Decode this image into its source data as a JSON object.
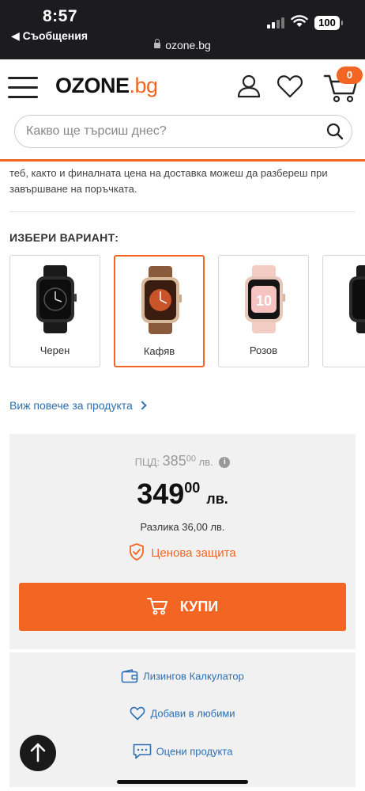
{
  "status_bar": {
    "time": "8:57",
    "back_label": "◀ Съобщения",
    "url": "ozone.bg",
    "battery": "100"
  },
  "header": {
    "logo_main": "OZONE",
    "logo_suffix": ".bg",
    "cart_count": "0",
    "search_placeholder": "Какво ще търсиш днес?",
    "accent_color": "#f26522"
  },
  "delivery_note": "теб, както и финалната цена на доставка можеш да разбереш при завършване на поръчката.",
  "variants": {
    "title": "ИЗБЕРИ ВАРИАНТ:",
    "items": [
      {
        "label": "Черен",
        "selected": false,
        "color": "#2a2a2a"
      },
      {
        "label": "Кафяв",
        "selected": true,
        "color": "#8a5a3c"
      },
      {
        "label": "Розов",
        "selected": false,
        "color": "#f2c6bd"
      },
      {
        "label": "",
        "selected": false,
        "color": "#2a2a2a"
      }
    ]
  },
  "more_link": "Виж повече за продукта",
  "price": {
    "old_label": "ПЦД:",
    "old_value": "385",
    "old_decimals": "00",
    "old_currency": "лв.",
    "info_icon": "i",
    "new_value": "349",
    "new_decimals": "00",
    "new_currency": "лв.",
    "difference": "Разлика 36,00 лв.",
    "protection": "Ценова защита",
    "buy_label": "КУПИ"
  },
  "actions": {
    "leasing": "Лизингов Калкулатор",
    "favorite": "Добави в любими",
    "rate": "Оцени продукта"
  }
}
